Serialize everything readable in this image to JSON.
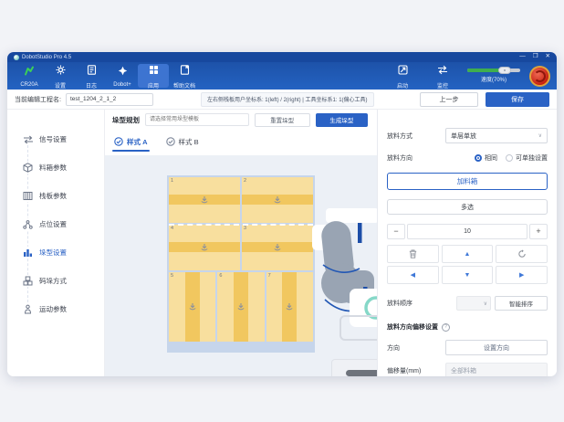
{
  "window": {
    "title": "DobotStudio Pro 4.5"
  },
  "titlebar": {
    "minimize": "—",
    "restore": "❐",
    "close": "✕"
  },
  "nav": {
    "robot_model": "CR20A",
    "items": [
      {
        "label": "设置"
      },
      {
        "label": "日志"
      },
      {
        "label": "Dobot+"
      },
      {
        "label": "应用",
        "active": true
      },
      {
        "label": "帮助文档"
      }
    ],
    "start_label": "启动",
    "monitor_label": "监控",
    "speed_label": "速度(70%)",
    "speed_percent": 70
  },
  "toolbar": {
    "project_label": "当前编辑工程名:",
    "project_name": "test_1204_2_1_2",
    "coord_info": "左右侧栈板用户坐标系: 1(left) / 2(right) | 工具坐标系1: 1(偏心工具)",
    "prev_button": "上一步",
    "save_button": "保存"
  },
  "sidebar": {
    "items": [
      {
        "label": "信号设置"
      },
      {
        "label": "料箱参数"
      },
      {
        "label": "栈板参数"
      },
      {
        "label": "点位设置"
      },
      {
        "label": "垛型设置",
        "active": true
      },
      {
        "label": "码垛方式"
      },
      {
        "label": "运动参数"
      }
    ]
  },
  "main": {
    "plan_label": "垛型规划",
    "plan_input": "请选择常用垛型模板",
    "reset_button": "重置垛型",
    "generate_button": "生成垛型",
    "tabs": [
      {
        "label": "样式 A",
        "active": true
      },
      {
        "label": "样式 B",
        "active": false
      }
    ],
    "pallet": {
      "boxes": [
        {
          "num": "1"
        },
        {
          "num": "2"
        },
        {
          "num": "4"
        },
        {
          "num": "3"
        },
        {
          "num": "5"
        },
        {
          "num": "6"
        },
        {
          "num": "7"
        }
      ]
    }
  },
  "panel": {
    "place_method_label": "放料方式",
    "place_method_value": "单层单放",
    "place_dir_label": "放料方向",
    "radio_same": "相同",
    "radio_individual": "可单独设置",
    "add_box_button": "加料箱",
    "multi_select_button": "多选",
    "stepper_minus": "−",
    "stepper_value": "10",
    "stepper_plus": "+",
    "move_up": "▲",
    "move_down": "▼",
    "move_left": "◀",
    "move_right": "▶",
    "order_label": "放料顺序",
    "smart_sort_button": "智能排序",
    "offset_section_title": "放料方向偏移设置",
    "direction_label": "方向",
    "direction_value": "设置方向",
    "offset_label": "偏移量(mm)",
    "offset_value": "全部料箱"
  },
  "colors": {
    "accent_blue": "#2a62c5",
    "nav_blue": "#2160bf",
    "box_yellow": "#f8df9e",
    "box_stripe": "#f1c75f",
    "pallet_blue": "#c6d5eb",
    "speed_green": "#3fae4e",
    "estop_red": "#c6200f"
  }
}
